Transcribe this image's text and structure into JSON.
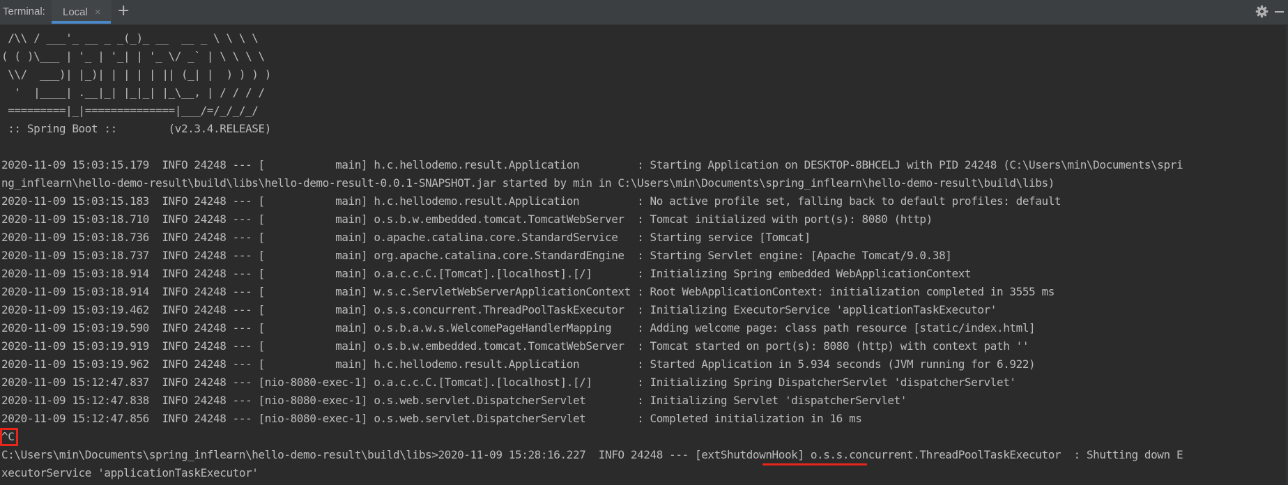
{
  "header": {
    "title": "Terminal:",
    "tab_label": "Local",
    "close_glyph": "×",
    "add_glyph": "+"
  },
  "icons": {
    "settings": "gear-icon",
    "minimize": "minimize-icon"
  },
  "colors": {
    "background": "#2b2b2b",
    "text": "#bbbbbb",
    "tab_accent": "#4a88c7",
    "annotation": "#e8261c"
  },
  "terminal": {
    "banner": [
      " /\\\\ / ___'_ __ _ _(_)_ __  __ _ \\ \\ \\ \\",
      "( ( )\\___ | '_ | '_| | '_ \\/ _` | \\ \\ \\ \\",
      " \\\\/  ___)| |_)| | | | | || (_| |  ) ) ) )",
      "  '  |____| .__|_| |_|_| |_\\__, | / / / /",
      " =========|_|==============|___/=/_/_/_/",
      " :: Spring Boot ::        (v2.3.4.RELEASE)"
    ],
    "log": [
      "2020-11-09 15:03:15.179  INFO 24248 --- [           main] h.c.hellodemo.result.Application         : Starting Application on DESKTOP-8BHCELJ with PID 24248 (C:\\Users\\min\\Documents\\spri",
      "ng_inflearn\\hello-demo-result\\build\\libs\\hello-demo-result-0.0.1-SNAPSHOT.jar started by min in C:\\Users\\min\\Documents\\spring_inflearn\\hello-demo-result\\build\\libs)",
      "2020-11-09 15:03:15.183  INFO 24248 --- [           main] h.c.hellodemo.result.Application         : No active profile set, falling back to default profiles: default",
      "2020-11-09 15:03:18.710  INFO 24248 --- [           main] o.s.b.w.embedded.tomcat.TomcatWebServer  : Tomcat initialized with port(s): 8080 (http)",
      "2020-11-09 15:03:18.736  INFO 24248 --- [           main] o.apache.catalina.core.StandardService   : Starting service [Tomcat]",
      "2020-11-09 15:03:18.737  INFO 24248 --- [           main] org.apache.catalina.core.StandardEngine  : Starting Servlet engine: [Apache Tomcat/9.0.38]",
      "2020-11-09 15:03:18.914  INFO 24248 --- [           main] o.a.c.c.C.[Tomcat].[localhost].[/]       : Initializing Spring embedded WebApplicationContext",
      "2020-11-09 15:03:18.914  INFO 24248 --- [           main] w.s.c.ServletWebServerApplicationContext : Root WebApplicationContext: initialization completed in 3555 ms",
      "2020-11-09 15:03:19.462  INFO 24248 --- [           main] o.s.s.concurrent.ThreadPoolTaskExecutor  : Initializing ExecutorService 'applicationTaskExecutor'",
      "2020-11-09 15:03:19.590  INFO 24248 --- [           main] o.s.b.a.w.s.WelcomePageHandlerMapping    : Adding welcome page: class path resource [static/index.html]",
      "2020-11-09 15:03:19.919  INFO 24248 --- [           main] o.s.b.w.embedded.tomcat.TomcatWebServer  : Tomcat started on port(s): 8080 (http) with context path ''",
      "2020-11-09 15:03:19.962  INFO 24248 --- [           main] h.c.hellodemo.result.Application         : Started Application in 5.934 seconds (JVM running for 6.922)",
      "2020-11-09 15:12:47.837  INFO 24248 --- [nio-8080-exec-1] o.a.c.c.C.[Tomcat].[localhost].[/]       : Initializing Spring DispatcherServlet 'dispatcherServlet'",
      "2020-11-09 15:12:47.838  INFO 24248 --- [nio-8080-exec-1] o.s.web.servlet.DispatcherServlet        : Initializing Servlet 'dispatcherServlet'",
      "2020-11-09 15:12:47.856  INFO 24248 --- [nio-8080-exec-1] o.s.web.servlet.DispatcherServlet        : Completed initialization in 16 ms"
    ],
    "interrupt": "^C",
    "shutdown": [
      "C:\\Users\\min\\Documents\\spring_inflearn\\hello-demo-result\\build\\libs>2020-11-09 15:28:16.227  INFO 24248 --- [extShutdownHook] o.s.s.concurrent.ThreadPoolTaskExecutor  : Shutting down E",
      "xecutorService 'applicationTaskExecutor'"
    ]
  }
}
